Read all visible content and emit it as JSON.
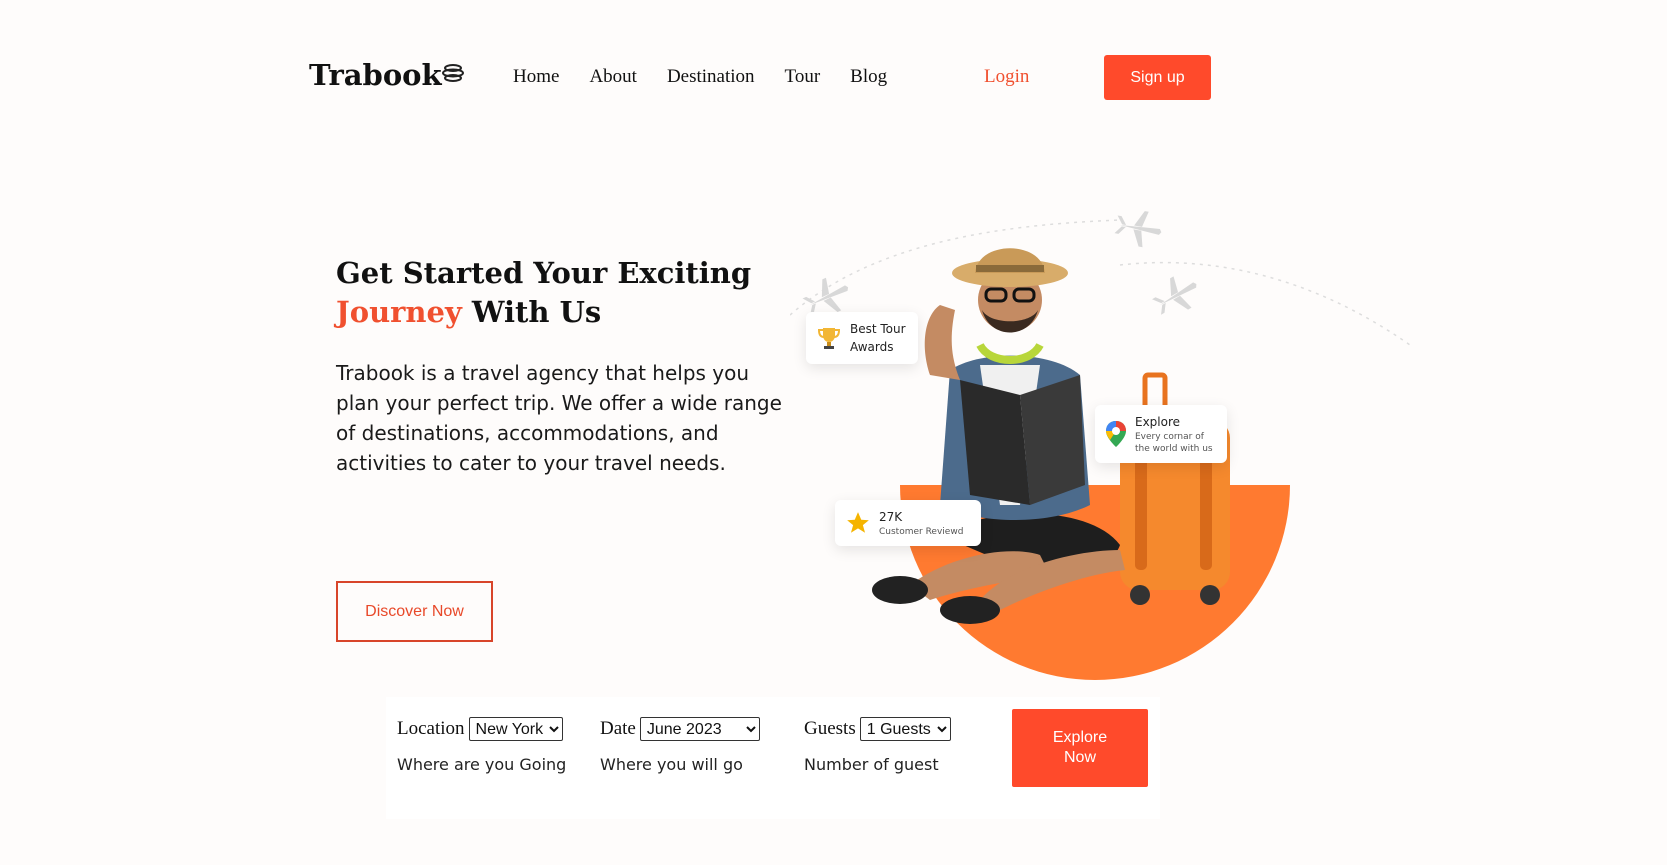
{
  "brand": {
    "name": "Trabook",
    "accent": "#ff4a2b"
  },
  "nav": {
    "items": [
      {
        "label": "Home"
      },
      {
        "label": "About"
      },
      {
        "label": "Destination"
      },
      {
        "label": "Tour"
      },
      {
        "label": "Blog"
      }
    ],
    "login_label": "Login",
    "signup_label": "Sign up"
  },
  "hero": {
    "title_line1": "Get Started Your Exciting",
    "title_accent": "Journey",
    "title_rest": " With Us",
    "description": "Trabook is a travel agency that helps you plan your perfect trip. We offer a wide range of destinations, accommodations, and activities to cater to your travel needs.",
    "cta_label": "Discover Now"
  },
  "badges": {
    "awards": {
      "line1": "Best Tour",
      "line2": "Awards",
      "icon": "trophy-icon"
    },
    "explore": {
      "title": "Explore",
      "line1": "Every cornar of",
      "line2": "the world with us",
      "icon": "map-pin-icon"
    },
    "reviews": {
      "count": "27K",
      "label": "Customer Reviewd",
      "icon": "star-icon"
    }
  },
  "search": {
    "location": {
      "label": "Location",
      "selected": "New York",
      "sub": "Where are you Going"
    },
    "date": {
      "label": "Date",
      "selected": "June 2023",
      "sub": "Where you will go"
    },
    "guests": {
      "label": "Guests",
      "selected": "1 Guests",
      "sub": "Number of guest"
    },
    "submit_label": "Explore Now"
  }
}
